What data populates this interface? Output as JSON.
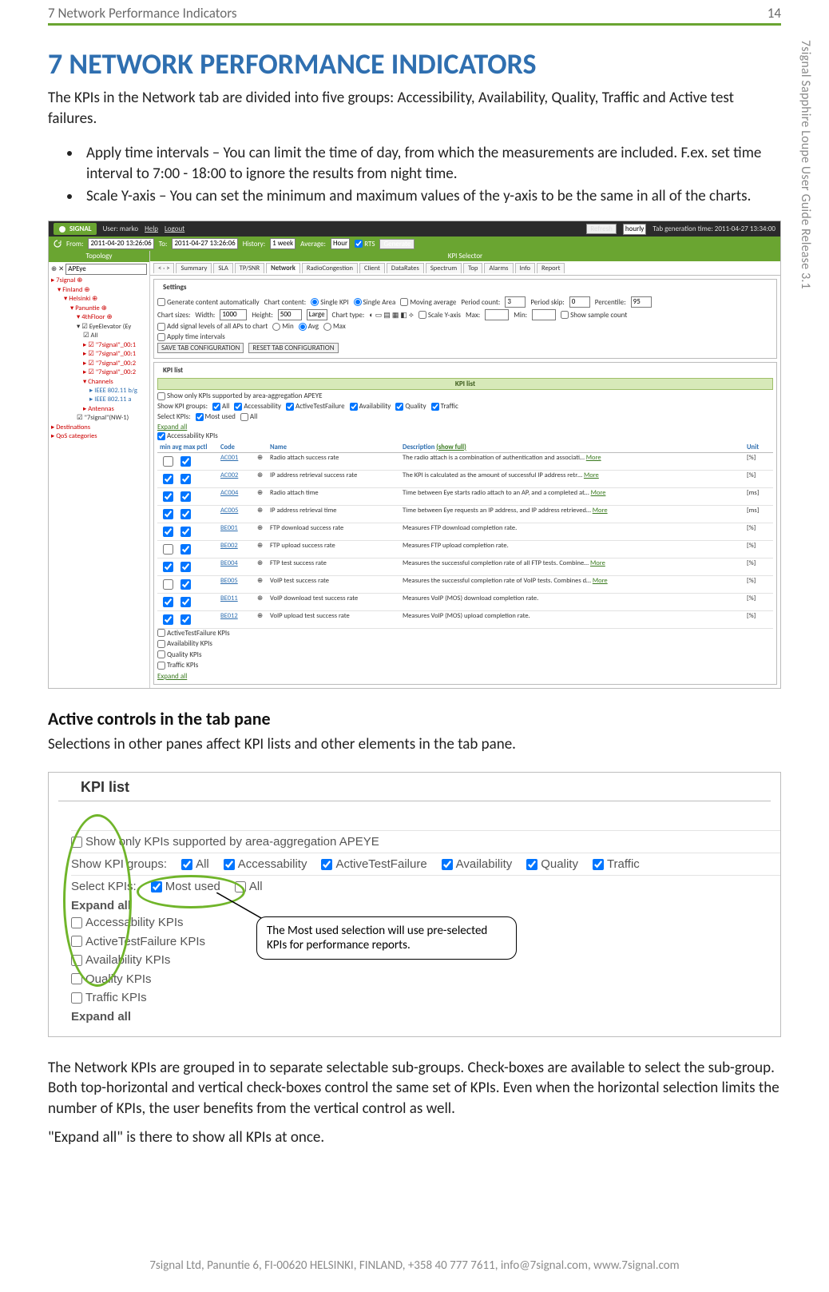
{
  "page": {
    "running_head_left": "7 Network Performance Indicators",
    "running_head_right": "14",
    "side_text": "7signal Sapphire Loupe User Guide Release 3.1",
    "footer": "7signal Ltd, Panuntie 6, FI-00620 HELSINKI, FINLAND, +358 40 777 7611, info@7signal.com, www.7signal.com"
  },
  "content": {
    "h1": "7 NETWORK PERFORMANCE INDICATORS",
    "intro": "The KPIs in the Network tab are divided into five groups: Accessibility, Availability, Quality, Traffic and Active test failures.",
    "bullet1": "Apply time intervals – You can limit the time of day, from which the measurements are included. F.ex. set time interval to 7:00 - 18:00 to ignore the results from night time.",
    "bullet2": "Scale Y-axis – You can set the minimum and maximum values of the y-axis to be the same in all of the charts.",
    "h2": "Active controls in the tab pane",
    "p2": "Selections in other panes affect KPI lists and other elements in the tab pane.",
    "callout": "The Most used selection will use pre-selected KPIs for performance reports.",
    "p3": "The Network KPIs are grouped in to separate selectable sub-groups. Check-boxes are available to select the sub-group. Both top-horizontal and vertical check-boxes control the same set of KPIs. Even when the horizontal selection limits the number of KPIs, the user benefits from the vertical control as well.",
    "p4": "\"Expand all\" is there to show all KPIs at once."
  },
  "shot1": {
    "brand": "SIGNAL",
    "user_label": "User: marko",
    "help": "Help",
    "logout": "Logout",
    "refresh": "Refresh",
    "refresh_val": "hourly",
    "tab_time_label": "Tab generation time: 2011-04-27 13:34:00",
    "from_label": "From:",
    "from_val": "2011-04-20 13:26:06",
    "to_label": "To:",
    "to_val": "2011-04-27 13:26:06",
    "hist_label": "History:",
    "hist_val": "1 week",
    "avg_label": "Average:",
    "avg_val": "Hour",
    "rts": "RTS",
    "generate": "Generate",
    "topology_hdr": "Topology",
    "apeye": "APEye",
    "tree": {
      "root": "7signal",
      "n_finland": "Finland",
      "n_helsinki": "Helsinki",
      "n_panuntie": "Panuntie",
      "n_floor": "4thFloor",
      "n_elev": "EyeElevator (Ey",
      "all": "All",
      "e1": "\"7signal\"_00:1",
      "e2": "\"7signal\"_00:1",
      "e3": "\"7signal\"_00:2",
      "e4": "\"7signal\"_00:2",
      "channels": "Channels",
      "ieee1": "IEEE 802.11 b/g",
      "ieee2": "IEEE 802.11 a",
      "ant": "Antennas",
      "nw": "\"7signal\"(NW-1)",
      "dest": "Destinations",
      "qos": "QoS categories"
    },
    "kpi_selector": "KPI Selector",
    "tabs": {
      "nav": "< · >",
      "summary": "Summary",
      "sla": "SLA",
      "tpsnr": "TP/SNR",
      "network": "Network",
      "radio": "RadioCongestion",
      "client": "Client",
      "datarates": "DataRates",
      "spectrum": "Spectrum",
      "top": "Top",
      "alarms": "Alarms",
      "info": "Info",
      "report": "Report"
    },
    "settings": {
      "title": "Settings",
      "gen_auto": "Generate content automatically",
      "chart_content": "Chart content:",
      "single_kpi": "Single KPI",
      "single_area": "Single Area",
      "moving_avg": "Moving average",
      "period_count_l": "Period count:",
      "period_count_v": "3",
      "period_skip_l": "Period skip:",
      "period_skip_v": "0",
      "percentile_l": "Percentile:",
      "percentile_v": "95",
      "chart_size_l": "Chart sizes:",
      "width_l": "Width:",
      "width_v": "1000",
      "height_l": "Height:",
      "height_v": "500",
      "large": "Large",
      "chart_type_l": "Chart type:",
      "scale_y": "Scale Y-axis",
      "max_l": "Max:",
      "min_l": "Min:",
      "show_sample": "Show sample count",
      "add_signal": "Add signal levels of all APs to chart",
      "min": "Min",
      "avg": "Avg",
      "max": "Max",
      "apply_ti": "Apply time intervals",
      "save_tab": "SAVE TAB CONFIGURATION",
      "reset_tab": "RESET TAB CONFIGURATION"
    },
    "kpi": {
      "title": "KPI list",
      "bar": "KPI list",
      "show_only": "Show only KPIs supported by area-aggregation APEYE",
      "show_groups": "Show KPI groups:",
      "all": "All",
      "acc": "Accessability",
      "atf": "ActiveTestFailure",
      "avail": "Availability",
      "quality": "Quality",
      "traffic": "Traffic",
      "select_kpis": "Select KPIs:",
      "most_used": "Most used",
      "expand_all": "Expand all",
      "acc_hdr": "Accessability KPIs",
      "min_avg_max_pctl": "min avg max pctl",
      "col_code": "Code",
      "col_name": "Name",
      "col_desc": "Description",
      "show_full": "(show full)",
      "col_unit": "Unit",
      "more": "More",
      "rows": [
        {
          "code": "AC001",
          "name": "Radio attach success rate",
          "desc": "The radio attach is a combination of authentication and associati…",
          "unit": "[%]",
          "more": true
        },
        {
          "code": "AC002",
          "name": "IP address retrieval success rate",
          "desc": "The KPI is calculated as the amount of successful IP address retr…",
          "unit": "[%]",
          "more": true
        },
        {
          "code": "AC004",
          "name": "Radio attach time",
          "desc": "Time between Eye starts radio attach to an AP, and a completed at…",
          "unit": "[ms]",
          "more": true
        },
        {
          "code": "AC005",
          "name": "IP address retrieval time",
          "desc": "Time between Eye requests an IP address, and IP address retrieved…",
          "unit": "[ms]",
          "more": true
        },
        {
          "code": "BE001",
          "name": "FTP download success rate",
          "desc": "Measures FTP download completion rate.",
          "unit": "[%]",
          "more": false
        },
        {
          "code": "BE002",
          "name": "FTP upload success rate",
          "desc": "Measures FTP upload completion rate.",
          "unit": "[%]",
          "more": false
        },
        {
          "code": "BE004",
          "name": "FTP test success rate",
          "desc": "Measures the successful completion rate of all FTP tests. Combine…",
          "unit": "[%]",
          "more": true
        },
        {
          "code": "BE005",
          "name": "VoIP test success rate",
          "desc": "Measures the successful completion rate of VoIP tests. Combines d…",
          "unit": "[%]",
          "more": true
        },
        {
          "code": "BE011",
          "name": "VoIP download test success rate",
          "desc": "Measures VoIP (MOS) download completion rate.",
          "unit": "[%]",
          "more": false
        },
        {
          "code": "BE012",
          "name": "VoIP upload test success rate",
          "desc": "Measures VoIP (MOS) upload completion rate.",
          "unit": "[%]",
          "more": false
        }
      ],
      "atf_hdr": "ActiveTestFailure KPIs",
      "avail_hdr": "Availability KPIs",
      "quality_hdr": "Quality KPIs",
      "traffic_hdr": "Traffic KPIs"
    }
  },
  "shot2": {
    "title": "KPI list",
    "show_only": "Show only KPIs supported by area-aggregation APEYE",
    "show_groups": "Show KPI groups:",
    "all": "All",
    "acc": "Accessability",
    "atf": "ActiveTestFailure",
    "avail": "Availability",
    "quality": "Quality",
    "traffic": "Traffic",
    "select_kpis": "Select KPIs:",
    "most_used": "Most used",
    "expand_all": "Expand all",
    "groups": [
      "Accessability KPIs",
      "ActiveTestFailure KPIs",
      "Availability KPIs",
      "Quality KPIs",
      "Traffic KPIs"
    ]
  }
}
